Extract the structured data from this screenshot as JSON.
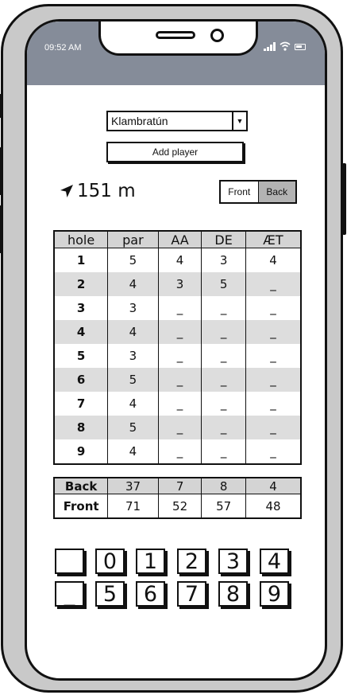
{
  "status_bar": {
    "time": "09:52 AM"
  },
  "course_select": {
    "value": "Klambratún"
  },
  "add_player": {
    "label": "Add player"
  },
  "distance": {
    "value": "151 m"
  },
  "nine_toggle": {
    "front": "Front",
    "back": "Back",
    "selected": "Back"
  },
  "scorecard": {
    "headers": [
      "hole",
      "par",
      "AA",
      "DE",
      "ÆT"
    ],
    "rows": [
      [
        "1",
        "5",
        "4",
        "3",
        "4"
      ],
      [
        "2",
        "4",
        "3",
        "5",
        "_"
      ],
      [
        "3",
        "3",
        "_",
        "_",
        "_"
      ],
      [
        "4",
        "4",
        "_",
        "_",
        "_"
      ],
      [
        "5",
        "3",
        "_",
        "_",
        "_"
      ],
      [
        "6",
        "5",
        "_",
        "_",
        "_"
      ],
      [
        "7",
        "4",
        "_",
        "_",
        "_"
      ],
      [
        "8",
        "5",
        "_",
        "_",
        "_"
      ],
      [
        "9",
        "4",
        "_",
        "_",
        "_"
      ]
    ]
  },
  "totals": {
    "back": [
      "Back",
      "37",
      "7",
      "8",
      "4"
    ],
    "front": [
      "Front",
      "71",
      "52",
      "57",
      "48"
    ]
  },
  "keypad": {
    "row1": [
      "",
      "0",
      "1",
      "2",
      "3",
      "4"
    ],
    "row2": [
      "_",
      "5",
      "6",
      "7",
      "8",
      "9"
    ]
  },
  "colors": {
    "status_bar": "#858c99",
    "phone_frame": "#c9c9c9",
    "selected_toggle": "#b3b3b3",
    "alt_row": "#dddddd"
  }
}
